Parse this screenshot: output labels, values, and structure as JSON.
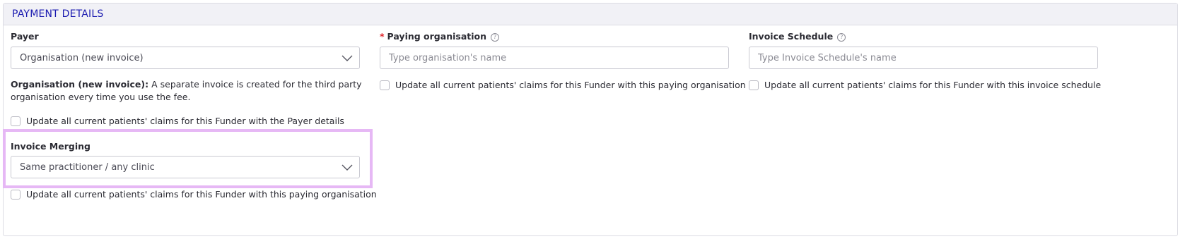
{
  "panel": {
    "title": "PAYMENT DETAILS"
  },
  "payer": {
    "label": "Payer",
    "value": "Organisation (new invoice)",
    "description_bold": "Organisation (new invoice):",
    "description_rest": " A separate invoice is created for the third party organisation every time you use the fee.",
    "checkbox_label": "Update all current patients' claims for this Funder with the Payer details"
  },
  "invoice_merging": {
    "label": "Invoice Merging",
    "value": "Same practitioner / any clinic",
    "checkbox_label": "Update all current patients' claims for this Funder with this paying organisation"
  },
  "paying_organisation": {
    "required_mark": "*",
    "label": "Paying organisation",
    "placeholder": "Type organisation's name",
    "checkbox_label": "Update all current patients' claims for this Funder with this paying organisation"
  },
  "invoice_schedule": {
    "label": "Invoice Schedule",
    "placeholder": "Type Invoice Schedule's name",
    "checkbox_label": "Update all current patients' claims for this Funder with this invoice schedule"
  },
  "icons": {
    "help": "question-circle-icon",
    "dropdown": "chevron-down-icon"
  },
  "colors": {
    "title": "#1a1ab0",
    "required": "#e0252b",
    "highlight": "#e6b8f5",
    "header_bg": "#f1f1f6"
  }
}
